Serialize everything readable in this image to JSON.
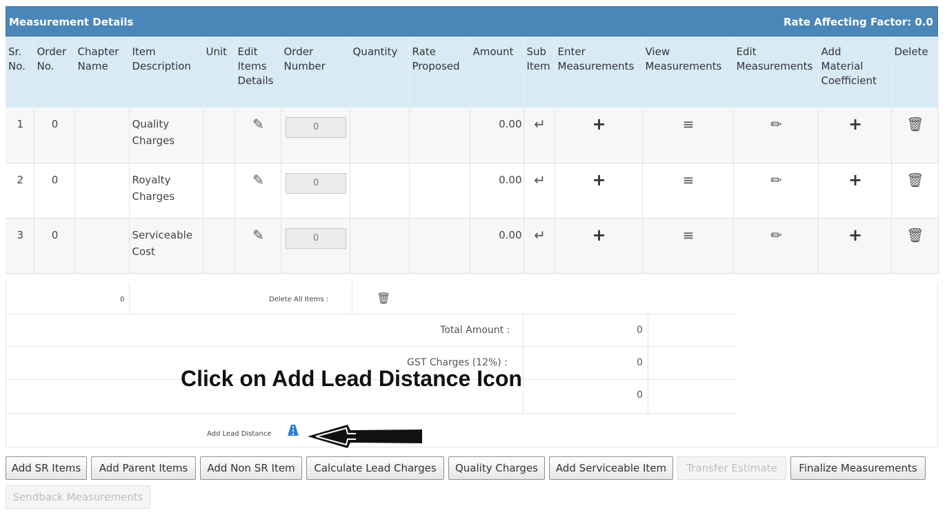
{
  "panel": {
    "title": "Measurement Details",
    "rate_factor": "Rate Affecting Factor: 0.0"
  },
  "columns": {
    "sr": [
      "Sr.",
      "No."
    ],
    "order": [
      "Order",
      "No."
    ],
    "chapter": [
      "Chapter",
      "Name"
    ],
    "item": [
      "Item",
      "Description"
    ],
    "unit": [
      "Unit"
    ],
    "edit": [
      "Edit",
      "Items",
      "Details"
    ],
    "ordnum": [
      "Order",
      "Number"
    ],
    "qty": [
      "Quantity"
    ],
    "rate": [
      "Rate",
      "Proposed"
    ],
    "amount": [
      "Amount"
    ],
    "sub": [
      "Sub",
      "Item"
    ],
    "enter": [
      "Enter",
      "Measurements"
    ],
    "view": [
      "View",
      "Measurements"
    ],
    "editm": [
      "Edit",
      "Measurements"
    ],
    "addmat": [
      "Add",
      "Material",
      "Coefficient"
    ],
    "delete": [
      "Delete"
    ]
  },
  "rows": [
    {
      "sr": "1",
      "order": "0",
      "desc": [
        "Quality",
        "Charges"
      ],
      "order_number": "0",
      "amount": "0.00"
    },
    {
      "sr": "2",
      "order": "0",
      "desc": [
        "Royalty",
        "Charges"
      ],
      "order_number": "0",
      "amount": "0.00"
    },
    {
      "sr": "3",
      "order": "0",
      "desc": [
        "Serviceable",
        "Cost"
      ],
      "order_number": "0",
      "amount": "0.00"
    }
  ],
  "summary": {
    "count": "0",
    "delete_all_label": "Delete All Items :",
    "total_label": "Total Amount :",
    "total_value": "0",
    "gst_label": "GST Charges (12%) :",
    "gst_value": "0",
    "third_value": "0",
    "add_lead_label": "Add Lead Distance"
  },
  "callout": "Click on Add Lead Distance Icon",
  "buttons": [
    {
      "label": "Add SR Items",
      "disabled": false
    },
    {
      "label": "Add Parent Items",
      "disabled": false
    },
    {
      "label": "Add Non SR Item",
      "disabled": false
    },
    {
      "label": "Calculate Lead Charges",
      "disabled": false
    },
    {
      "label": "Quality Charges",
      "disabled": false
    },
    {
      "label": "Add Serviceable Item",
      "disabled": false
    },
    {
      "label": "Transfer Estimate",
      "disabled": true
    },
    {
      "label": "Finalize Measurements",
      "disabled": false
    },
    {
      "label": "Sendback Measurements",
      "disabled": true
    }
  ],
  "icons": {
    "edit_details": "edit-square-icon",
    "sub_item": "sub-item-arrow-icon",
    "enter": "plus-icon",
    "view": "list-icon",
    "edit_measure": "pencil-icon",
    "add_material": "plus-icon",
    "delete": "trash-icon",
    "lead_distance": "road-icon"
  },
  "colors": {
    "header": "#4a86b8",
    "column_header": "#d9eaf7",
    "lead_icon": "#2f7fd0"
  }
}
